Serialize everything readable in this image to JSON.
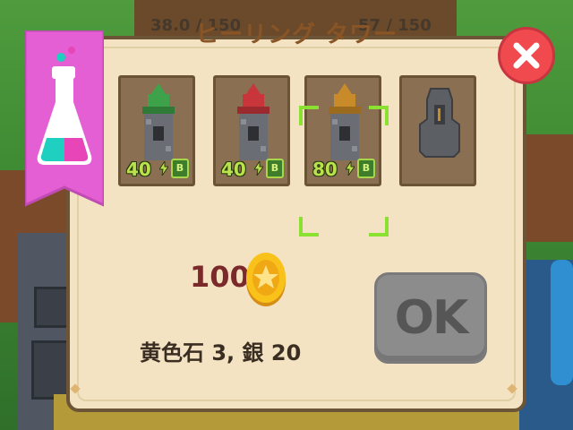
{
  "hud": {
    "left_stat": "38.0 / 150",
    "right_stat": "57 / 150"
  },
  "dialog": {
    "title": "ヒーリング タワー",
    "close_icon": "close-icon",
    "slots": [
      {
        "name": "green-healing-tower",
        "cost": "40",
        "badge": "B",
        "selected": false,
        "color": "#3da24a"
      },
      {
        "name": "red-healing-tower",
        "cost": "40",
        "badge": "B",
        "selected": false,
        "color": "#c8353a"
      },
      {
        "name": "orange-healing-tower",
        "cost": "80",
        "badge": "B",
        "selected": true,
        "color": "#c98a2a"
      },
      {
        "name": "locked-tower",
        "cost": "",
        "badge": "",
        "selected": false,
        "color": "#555555"
      }
    ],
    "price": "100",
    "coin_icon": "gold-coin-icon",
    "requirements": "黄色石 3, 銀 20",
    "ok_label": "OK"
  },
  "banner": {
    "icon": "potion-flask-icon",
    "color": "#e35fd3"
  }
}
